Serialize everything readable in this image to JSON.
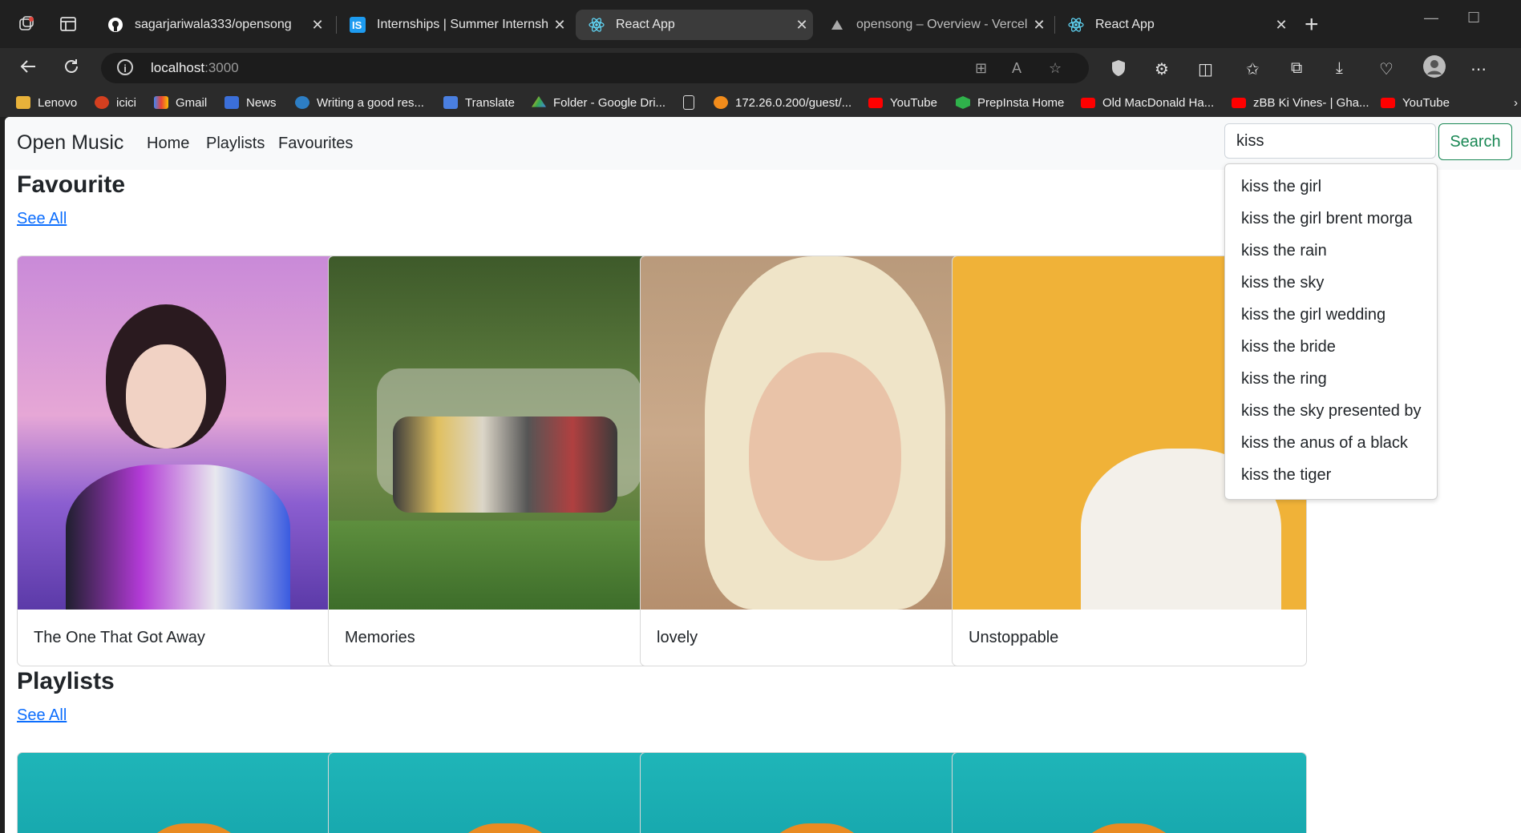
{
  "browser": {
    "tabs": [
      {
        "title": "sagarjariwala333/opensong",
        "active": false
      },
      {
        "title": "Internships | Summer Internship",
        "active": false
      },
      {
        "title": "React App",
        "active": true
      },
      {
        "title": "opensong – Overview - Vercel",
        "active": false
      },
      {
        "title": "React App",
        "active": false
      }
    ],
    "url_host": "localhost",
    "url_port": ":3000",
    "bookmarks": [
      {
        "label": "Lenovo",
        "color": "#e8b23a"
      },
      {
        "label": "icici",
        "color": "#d43f1f"
      },
      {
        "label": "Gmail",
        "color": "#ea4335"
      },
      {
        "label": "News",
        "color": "#3b6fd9"
      },
      {
        "label": "Writing a good res...",
        "color": "#2d7ec4"
      },
      {
        "label": "Translate",
        "color": "#4a7fe0"
      },
      {
        "label": "Folder - Google Dri...",
        "color": "#34a853"
      },
      {
        "label": "",
        "color": "#cccccc"
      },
      {
        "label": "172.26.0.200/guest/...",
        "color": "#f28c1b"
      },
      {
        "label": "YouTube",
        "color": "#ff0000"
      },
      {
        "label": "PrepInsta Home",
        "color": "#2fb24b"
      },
      {
        "label": "Old MacDonald Ha...",
        "color": "#ff0000"
      },
      {
        "label": "zBB Ki Vines- | Gha...",
        "color": "#ff0000"
      },
      {
        "label": "YouTube",
        "color": "#ff0000"
      }
    ]
  },
  "app": {
    "brand": "Open Music",
    "nav": {
      "home": "Home",
      "playlists": "Playlists",
      "favourites": "Favourites"
    },
    "search": {
      "value": "kiss",
      "button": "Search"
    },
    "suggestions": [
      "kiss the girl",
      "kiss the girl brent morga",
      "kiss the rain",
      "kiss the sky",
      "kiss the girl wedding",
      "kiss the bride",
      "kiss the ring",
      "kiss the sky presented by",
      "kiss the anus of a black",
      "kiss the tiger"
    ],
    "favourite": {
      "title": "Favourite",
      "see_all": "See All",
      "cards": [
        {
          "title": "The One That Got Away"
        },
        {
          "title": "Memories"
        },
        {
          "title": "lovely"
        },
        {
          "title": "Unstoppable"
        }
      ]
    },
    "playlists": {
      "title": "Playlists",
      "see_all": "See All"
    }
  },
  "colors": {
    "accent_link": "#0d6efd",
    "search_green": "#198754",
    "navbar_bg": "#f8f9fa"
  }
}
